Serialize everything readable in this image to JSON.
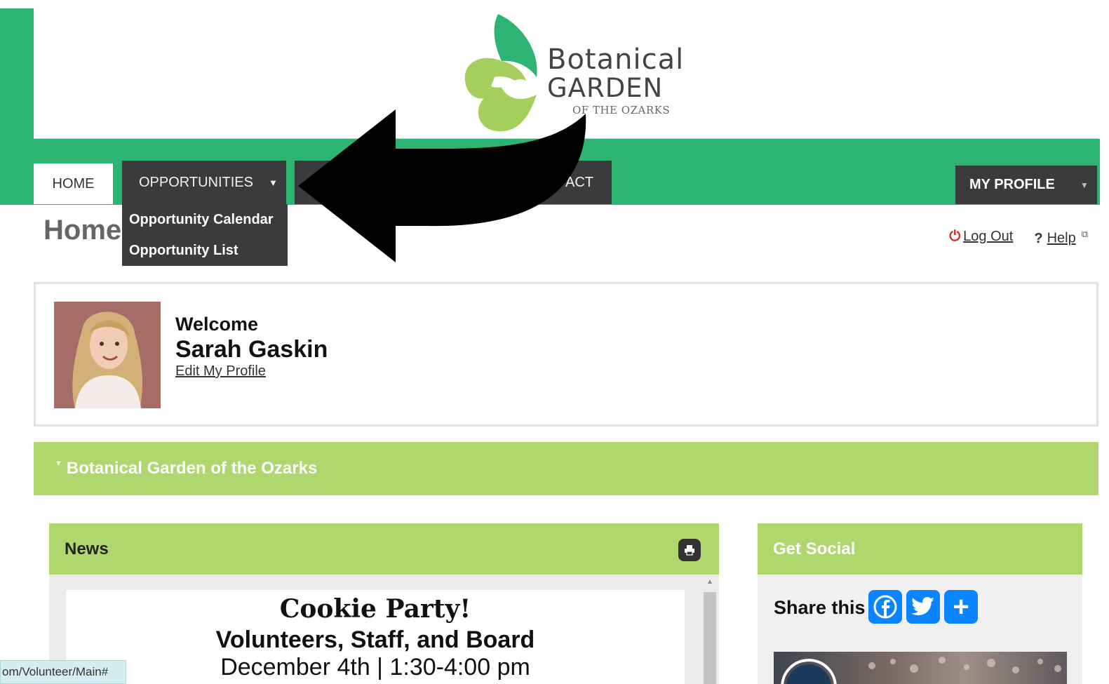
{
  "header": {
    "logo_line1": "Botanical",
    "logo_line2": "GARDEN",
    "logo_line3": "OF THE OZARKS"
  },
  "nav": {
    "home": "HOME",
    "opportunities": "OPPORTUNITIES",
    "contact": "ACT",
    "profile": "MY PROFILE",
    "dropdown": [
      "Opportunity Calendar",
      "Opportunity List"
    ]
  },
  "page": {
    "title": "Home",
    "logout": "Log Out",
    "help": "Help"
  },
  "welcome": {
    "label": "Welcome",
    "name": "Sarah Gaskin",
    "edit_link": "Edit My Profile"
  },
  "org_bar": "Botanical Garden of the Ozarks",
  "news": {
    "header": "News",
    "title": "Cookie Party!",
    "subtitle": "Volunteers, Staff, and Board",
    "date": "December 4th | 1:30-4:00 pm"
  },
  "social": {
    "header": "Get Social",
    "share_label": "Share this"
  },
  "status_url": "om/Volunteer/Main#",
  "colors": {
    "brand_green": "#2db472",
    "light_green": "#b0d66e",
    "nav_dark": "#3b3b3b",
    "share_blue": "#0b84ff"
  },
  "icons": [
    "power-icon",
    "external-link-icon",
    "caret-down-icon",
    "print-icon",
    "facebook-icon",
    "twitter-icon",
    "plus-icon",
    "arrow-annotation"
  ]
}
